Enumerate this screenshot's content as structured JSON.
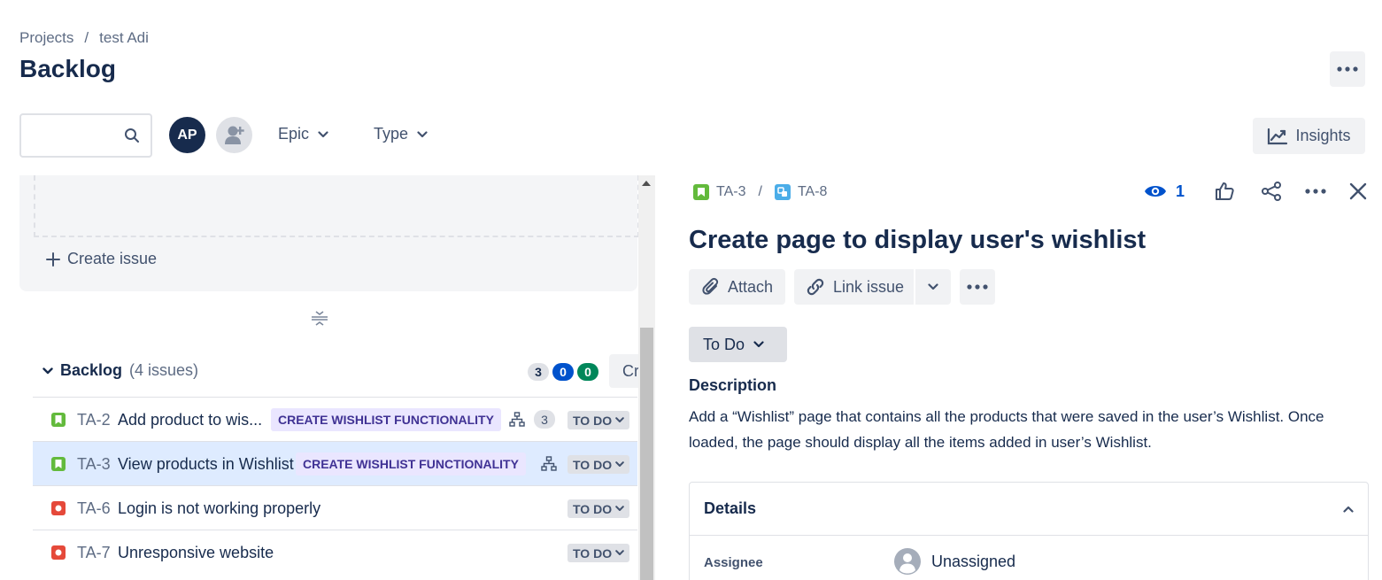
{
  "breadcrumb": {
    "projects": "Projects",
    "separator": "/",
    "project": "test Adi"
  },
  "page_title": "Backlog",
  "toolbar": {
    "search_placeholder": "",
    "avatar_initials": "AP",
    "epic_filter": "Epic",
    "type_filter": "Type",
    "insights_label": "Insights"
  },
  "sprint": {
    "create_issue_label": "Create issue"
  },
  "backlog": {
    "title": "Backlog",
    "count_label": "(4 issues)",
    "status_counts": [
      {
        "value": "3",
        "color": "#dfe1e6",
        "text_color": "#172b4d"
      },
      {
        "value": "0",
        "color": "#0052cc",
        "text_color": "#ffffff"
      },
      {
        "value": "0",
        "color": "#00875a",
        "text_color": "#ffffff"
      }
    ],
    "create_label": "Cr",
    "issues": [
      {
        "key": "TA-2",
        "summary": "Add product to wis...",
        "type": "story",
        "epic": "CREATE WISHLIST FUNCTIONALITY",
        "child_count": "3",
        "status": "TO DO",
        "selected": false
      },
      {
        "key": "TA-3",
        "summary": "View products in Wishlist",
        "type": "story",
        "epic": "CREATE WISHLIST FUNCTIONALITY",
        "child_count": "",
        "status": "TO DO",
        "selected": true
      },
      {
        "key": "TA-6",
        "summary": "Login is not working properly",
        "type": "bug",
        "epic": "",
        "child_count": "",
        "status": "TO DO",
        "selected": false
      },
      {
        "key": "TA-7",
        "summary": "Unresponsive website",
        "type": "bug",
        "epic": "",
        "child_count": "",
        "status": "TO DO",
        "selected": false
      }
    ]
  },
  "detail": {
    "parent_key": "TA-3",
    "separator": "/",
    "issue_key": "TA-8",
    "watchers": "1",
    "title": "Create page to display user's wishlist",
    "attach_label": "Attach",
    "link_issue_label": "Link issue",
    "status": "To Do",
    "description_title": "Description",
    "description": "Add a “Wishlist” page that contains all the products that were saved in the user’s Wishlist. Once loaded, the page should display all the items added in user’s Wishlist.",
    "details_title": "Details",
    "assignee_label": "Assignee",
    "assignee_value": "Unassigned"
  },
  "colors": {
    "story": "#63ba3c",
    "bug": "#e5493a",
    "subtask": "#4bade8",
    "selected_row": "#deebff",
    "epic_bg": "#eae6ff",
    "epic_text": "#403294",
    "link": "#0052cc"
  }
}
